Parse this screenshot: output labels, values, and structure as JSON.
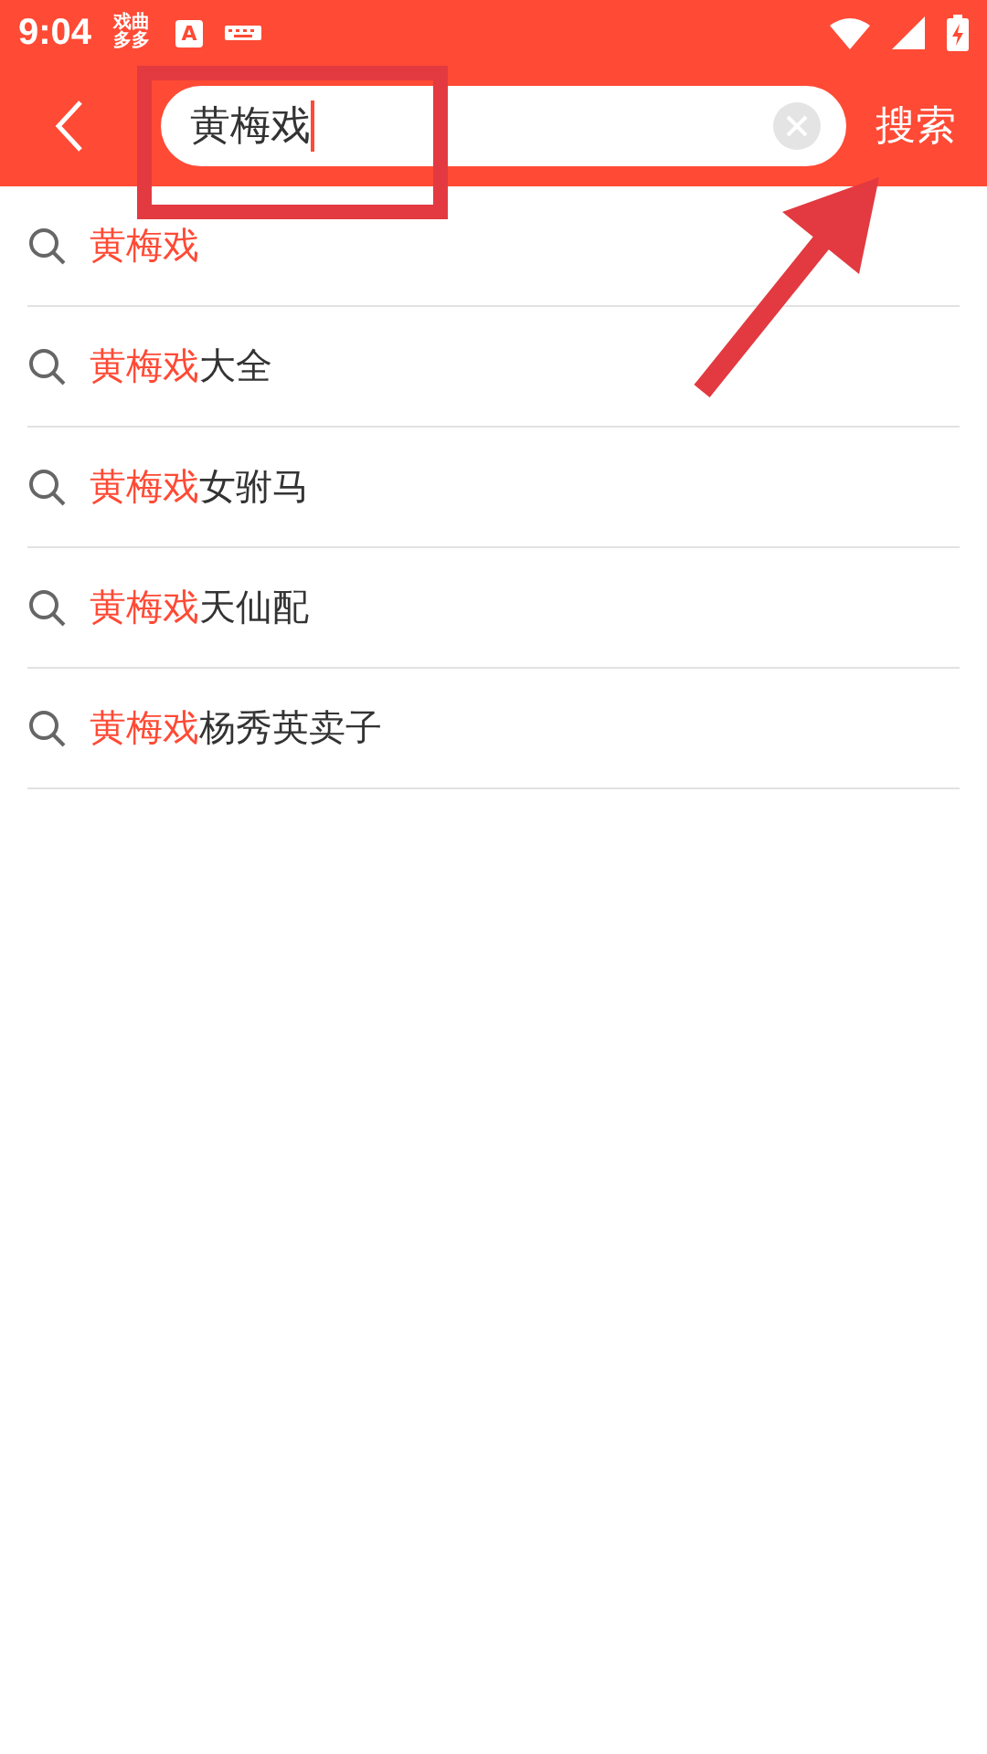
{
  "status_bar": {
    "time": "9:04",
    "app_icon_text": "戏曲多多",
    "keyboard_badge": "A"
  },
  "search": {
    "value": "黄梅戏",
    "action": "搜索"
  },
  "suggestions": [
    {
      "match": "黄梅戏"
    },
    {
      "match": "黄梅戏",
      "rest": "大全"
    },
    {
      "match": "黄梅戏",
      "rest": "女驸马"
    },
    {
      "match": "黄梅戏",
      "rest": "天仙配"
    },
    {
      "match": "黄梅戏",
      "rest": "杨秀英卖子"
    }
  ],
  "annotations": {
    "highlight_box": true,
    "arrow": true
  }
}
